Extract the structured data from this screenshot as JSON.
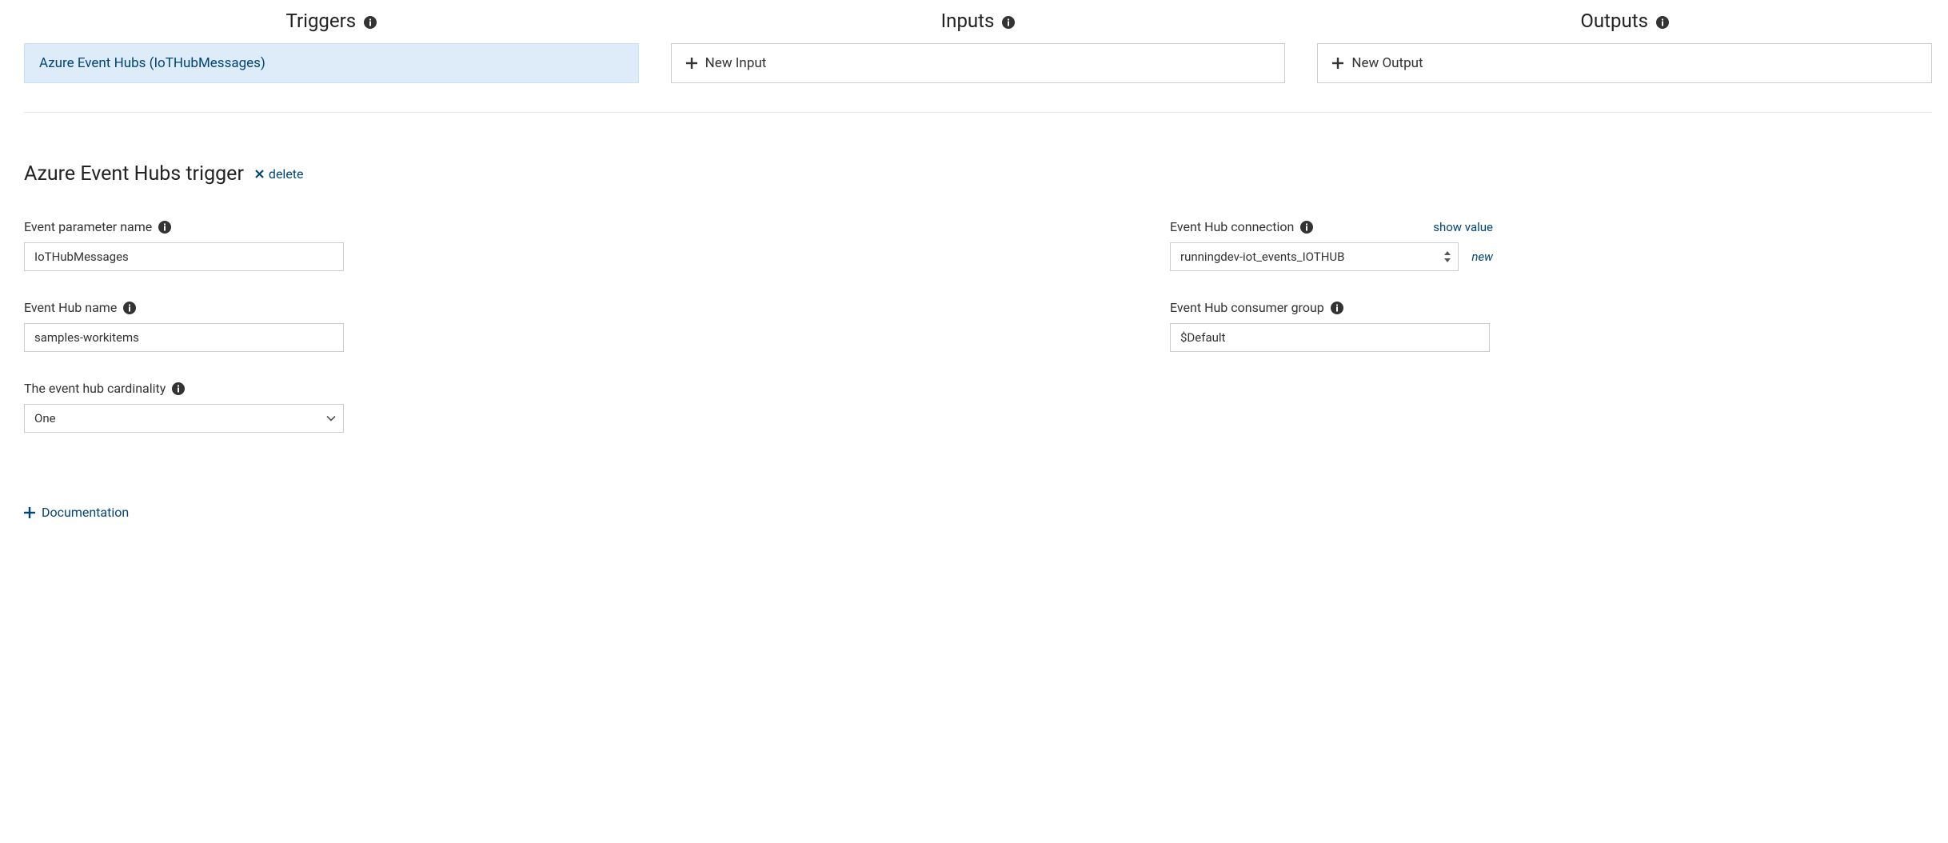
{
  "columns": {
    "triggers": {
      "title": "Triggers",
      "item": "Azure Event Hubs (IoTHubMessages)"
    },
    "inputs": {
      "title": "Inputs",
      "new_label": "New Input"
    },
    "outputs": {
      "title": "Outputs",
      "new_label": "New Output"
    }
  },
  "detail": {
    "title": "Azure Event Hubs trigger",
    "delete_label": "delete",
    "fields": {
      "param_name": {
        "label": "Event parameter name",
        "value": "IoTHubMessages"
      },
      "connection": {
        "label": "Event Hub connection",
        "show_value_label": "show value",
        "value": "runningdev-iot_events_IOTHUB",
        "new_label": "new"
      },
      "hub_name": {
        "label": "Event Hub name",
        "value": "samples-workitems"
      },
      "consumer_group": {
        "label": "Event Hub consumer group",
        "value": "$Default"
      },
      "cardinality": {
        "label": "The event hub cardinality",
        "value": "One"
      }
    },
    "documentation_label": "Documentation"
  }
}
